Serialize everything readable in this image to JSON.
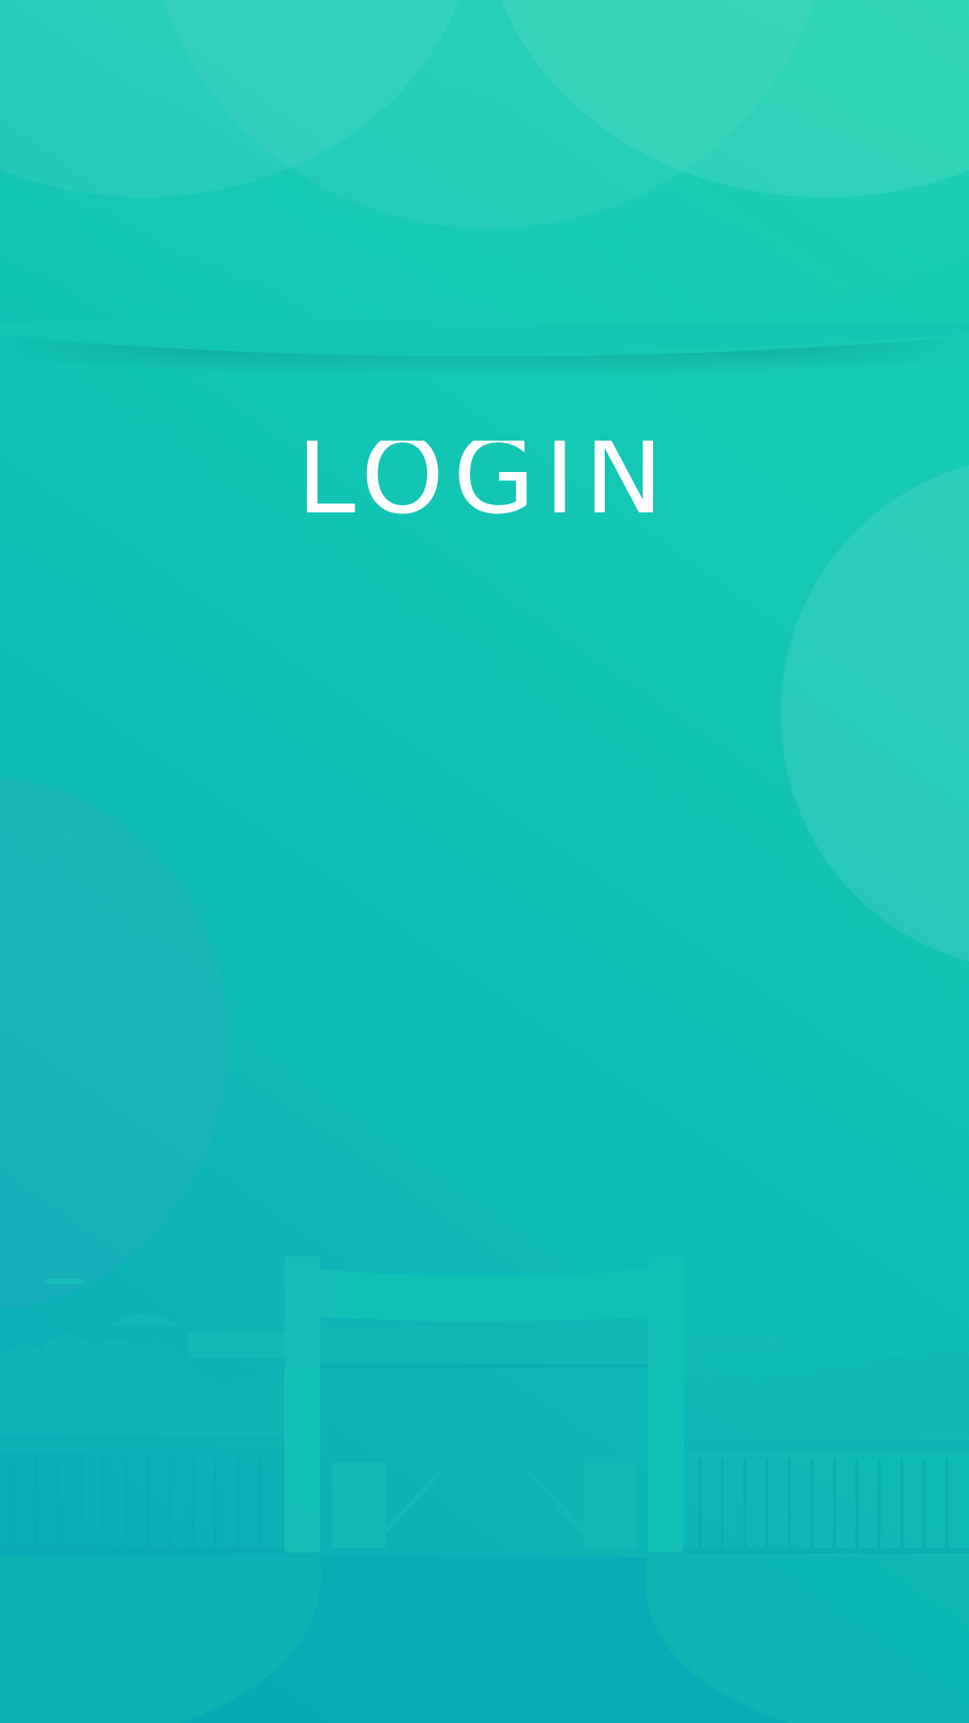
{
  "screen": {
    "title": "LOGIN",
    "colors": {
      "gradient_top": "#1bd0b0",
      "gradient_bottom": "#06a9b6",
      "title": "#ffffff"
    }
  },
  "illustration": {
    "icon": "campus-gate-illustration-icon"
  }
}
